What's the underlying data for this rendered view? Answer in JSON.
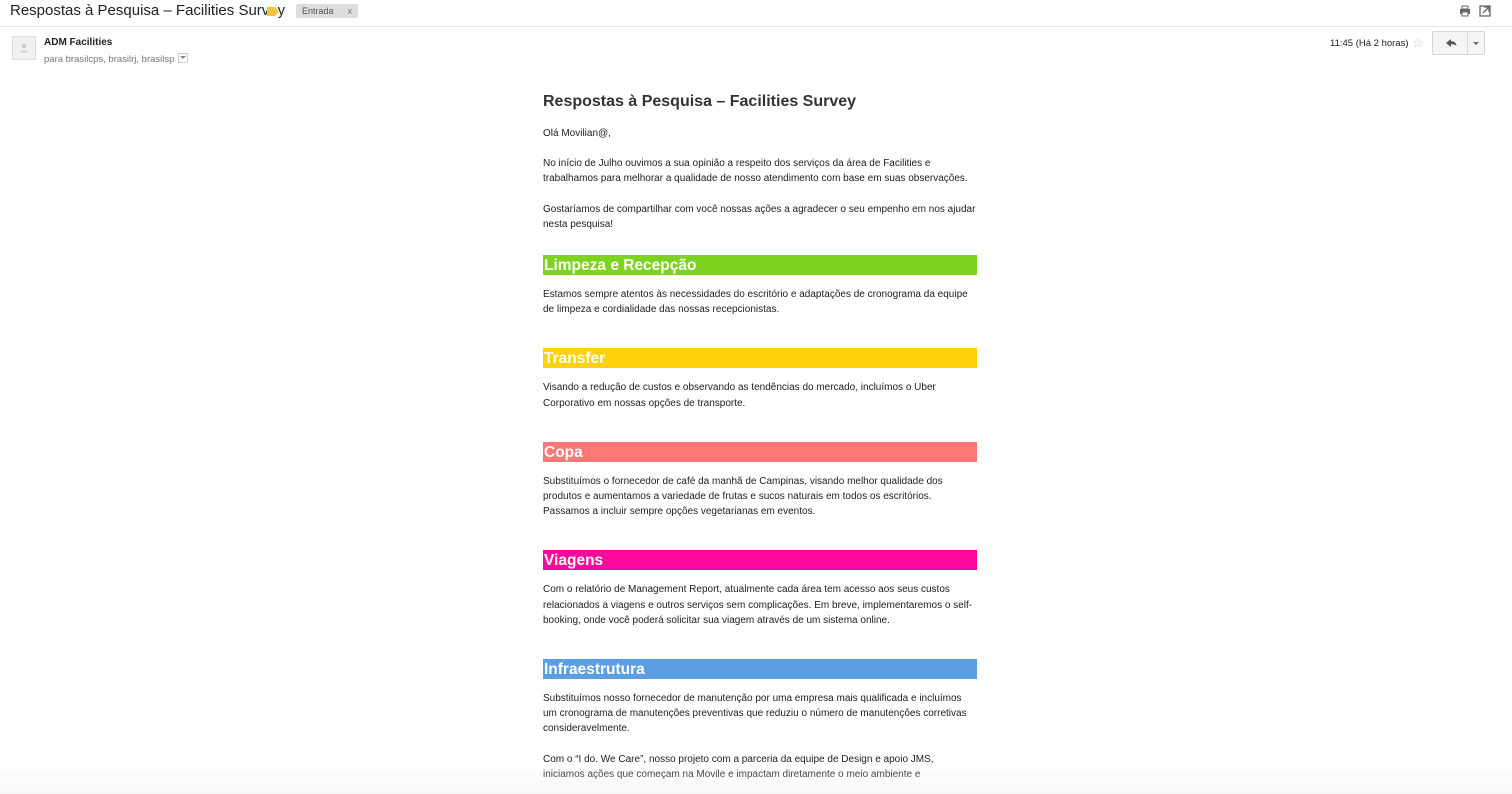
{
  "subject": "Respostas à Pesquisa – Facilities Survey",
  "label": {
    "name": "Entrada",
    "remove": "x",
    "color": "#f4c542"
  },
  "sender": "ADM Facilities",
  "recipients": "para brasilcps, brasilrj, brasilsp",
  "time": "11:45 (Há 2 horas)",
  "email": {
    "title": "Respostas à Pesquisa – Facilities Survey",
    "greeting": "Olá Movilian@,",
    "intro1": "No início de Julho ouvimos a sua opinião a respeito dos serviços da área de Facilities e trabalhamos para melhorar a qualidade de nosso atendimento com base em suas observações.",
    "intro2": "Gostaríamos de compartilhar com você nossas ações a agradecer o seu empenho em nos ajudar nesta pesquisa!",
    "sections": [
      {
        "title": "Limpeza e Recepção",
        "color": "#7ed321",
        "text": "Estamos sempre atentos às necessidades do escritório e adaptações de cronograma da equipe de limpeza e cordialidade das nossas recepcionistas."
      },
      {
        "title": "Transfer",
        "color": "#fcd20a",
        "text": "Visando a redução de custos e observando as tendências do mercado, incluímos o Uber Corporativo em nossas opções de transporte."
      },
      {
        "title": "Copa",
        "color": "#fc7876",
        "text": "Substituímos o fornecedor de café da manhã de Campinas, visando melhor qualidade dos produtos e aumentamos a variedade de frutas e sucos naturais em todos os escritórios. Passamos a incluir sempre opções vegetarianas em eventos."
      },
      {
        "title": "Viagens",
        "color": "#fc0a9c",
        "text": "Com o relatório de Management Report, atualmente cada área tem acesso aos seus custos relacionados a viagens e outros serviços sem complicações. Em breve, implementaremos o self-booking, onde você poderá solicitar sua viagem através de um sistema online."
      },
      {
        "title": "Infraestrutura",
        "color": "#5b9fe2",
        "text": "Substituímos nosso fornecedor de manutenção por uma empresa mais qualificada e incluímos um cronograma de manutenções preventivas que reduziu o número de manutenções corretivas consideravelmente."
      }
    ],
    "closing": "Com o “I do. We Care”, nosso projeto com a parceria da equipe de Design e apoio JMS, iniciamos ações que começam na Movile e impactam diretamente o meio ambiente e"
  }
}
